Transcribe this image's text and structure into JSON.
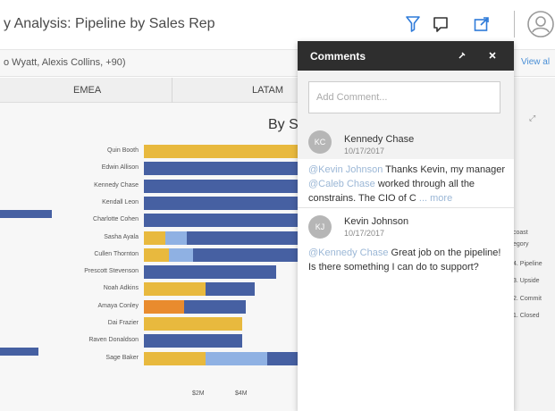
{
  "header": {
    "title": "y Analysis: Pipeline by Sales Rep",
    "filter_text": "o Wyatt, Alexis Collins, +90)",
    "view_link": "View al",
    "icons": [
      "filter-icon",
      "comment-icon",
      "share-icon",
      "user-icon"
    ]
  },
  "regions": [
    "EMEA",
    "LATAM"
  ],
  "chart_title": "By S",
  "chart_data": {
    "type": "bar",
    "categories": [
      "Quin Booth",
      "Edwin Allison",
      "Kennedy Chase",
      "Kendall Leon",
      "Charlotte Cohen",
      "Sasha Ayala",
      "Cullen Thornton",
      "Prescott Stevenson",
      "Noah Adkins",
      "Amaya Conley",
      "Dai Frazier",
      "Raven Donaldson",
      "Sage Baker"
    ],
    "series": [
      {
        "name": "",
        "values": [
          5.0,
          0,
          0,
          0,
          0,
          0.7,
          0.8,
          0,
          2.0,
          0.0,
          3.2,
          0,
          2.0
        ],
        "color": "#e8b93e"
      },
      {
        "name": "",
        "values": [
          0,
          0,
          0,
          0,
          0,
          0,
          0,
          0,
          0,
          1.3,
          0,
          0,
          0
        ],
        "color": "#e98b2e"
      },
      {
        "name": "",
        "values": [
          0,
          0,
          0,
          0,
          0,
          0.7,
          0.8,
          0,
          0,
          0,
          0,
          0,
          2.0
        ],
        "color": "#8fb1e3"
      },
      {
        "name": "",
        "values": [
          0,
          5.0,
          5.0,
          5.0,
          5.0,
          3.6,
          3.5,
          4.3,
          1.6,
          2.0,
          0,
          3.2,
          1.2
        ],
        "color": "#4660a2"
      }
    ],
    "xticks": [
      "$2M",
      "$4M"
    ],
    "xlim": [
      0,
      5
    ]
  },
  "left_bars": [
    1.6,
    0,
    1.2
  ],
  "panel": {
    "title": "Comments",
    "input_placeholder": "Add Comment...",
    "comments": [
      {
        "initials": "KC",
        "name": "Kennedy Chase",
        "date": "10/17/2017",
        "mention": "@Kevin Johnson",
        "text1": " Thanks Kevin, my manager ",
        "mention2": "@Caleb Chase",
        "text2": " worked through all the constrains. The CIO of C",
        "more": "... more"
      },
      {
        "initials": "KJ",
        "name": "Kevin Johnson",
        "date": "10/17/2017",
        "mention": "@Kennedy Chase",
        "text1": " Great job on the pipeline! Is there something I can do to support?"
      }
    ]
  },
  "legend": {
    "title1": "coast",
    "title2": "egory",
    "items": [
      "4. Pipeline",
      "3. Upside",
      "2. Commit",
      "1. Closed"
    ]
  }
}
